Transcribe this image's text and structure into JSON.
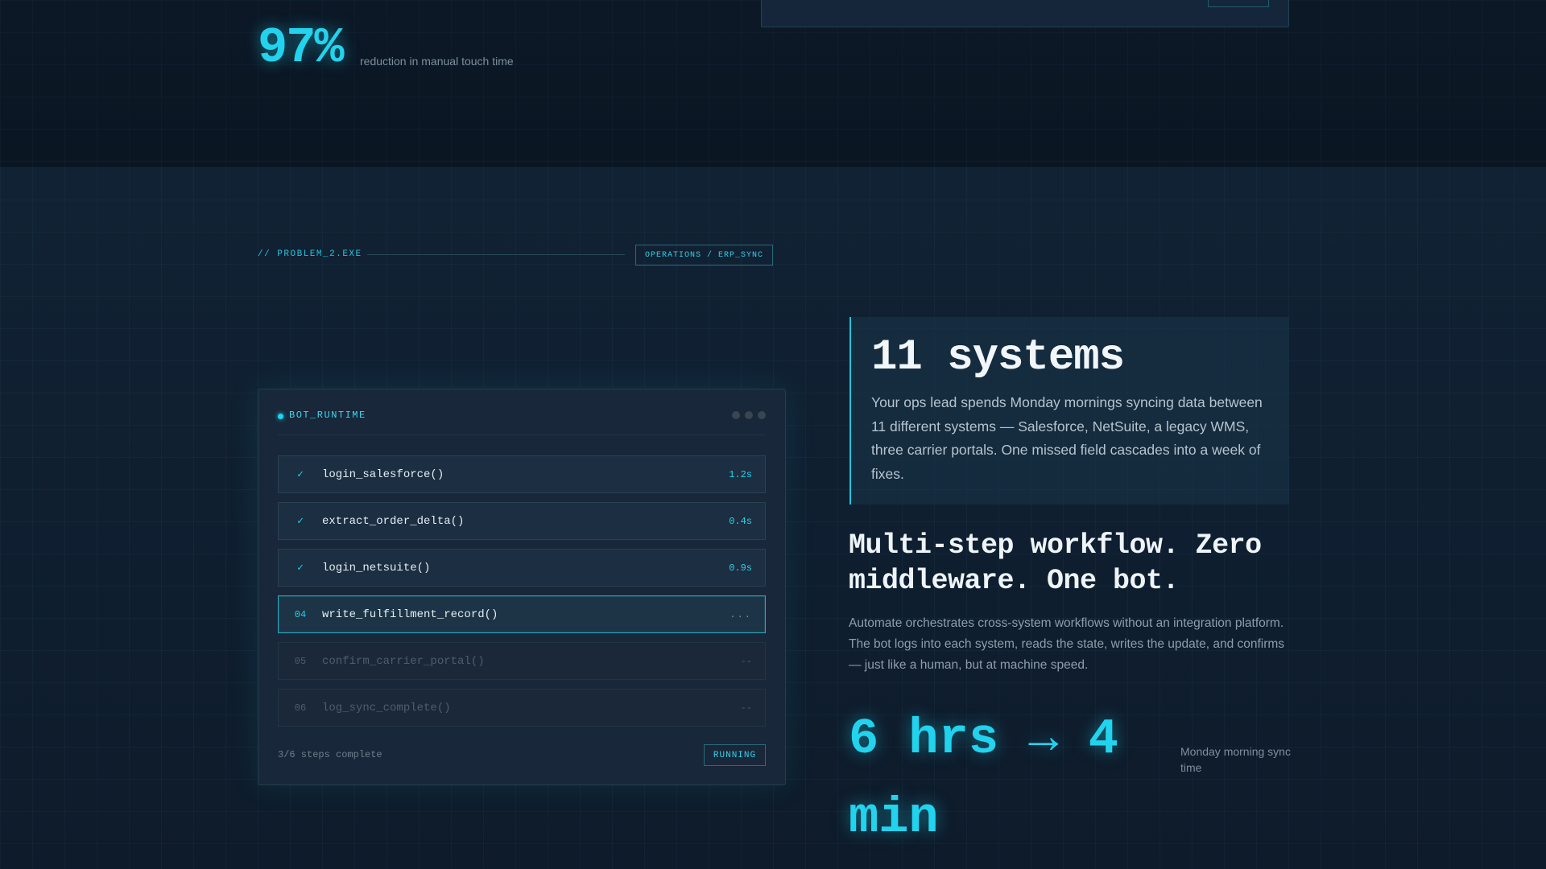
{
  "top_stat": {
    "value": "97%",
    "caption": "reduction in manual touch time"
  },
  "section": {
    "tag": "// PROBLEM_2.EXE",
    "badge": "OPERATIONS / ERP_SYNC"
  },
  "bot_panel": {
    "title": "BOT_RUNTIME",
    "steps": [
      {
        "num": "✓",
        "fn": "login_salesforce()",
        "time": "1.2s",
        "state": "done"
      },
      {
        "num": "✓",
        "fn": "extract_order_delta()",
        "time": "0.4s",
        "state": "done"
      },
      {
        "num": "✓",
        "fn": "login_netsuite()",
        "time": "0.9s",
        "state": "done"
      },
      {
        "num": "04",
        "fn": "write_fulfillment_record()",
        "time": "...",
        "state": "active"
      },
      {
        "num": "05",
        "fn": "confirm_carrier_portal()",
        "time": "--",
        "state": "pending"
      },
      {
        "num": "06",
        "fn": "log_sync_complete()",
        "time": "--",
        "state": "pending"
      }
    ],
    "footer": "3/6 steps complete",
    "status": "RUNNING"
  },
  "callout": {
    "title": "11 systems",
    "body": "Your ops lead spends Monday mornings syncing data between 11 different systems — Salesforce, NetSuite, a legacy WMS, three carrier portals. One missed field cascades into a week of fixes."
  },
  "headline": "Multi-step workflow. Zero middleware. One bot.",
  "body_text": "Automate orchestrates cross-system workflows without an integration platform. The bot logs into each system, reads the state, writes the update, and confirms — just like a human, but at machine speed.",
  "metric": {
    "value": "6 hrs → 4 min",
    "caption": "Monday morning sync time"
  },
  "colors": {
    "accent": "#22d3ee",
    "background": "#0e1a28",
    "panel": "#18273a"
  }
}
